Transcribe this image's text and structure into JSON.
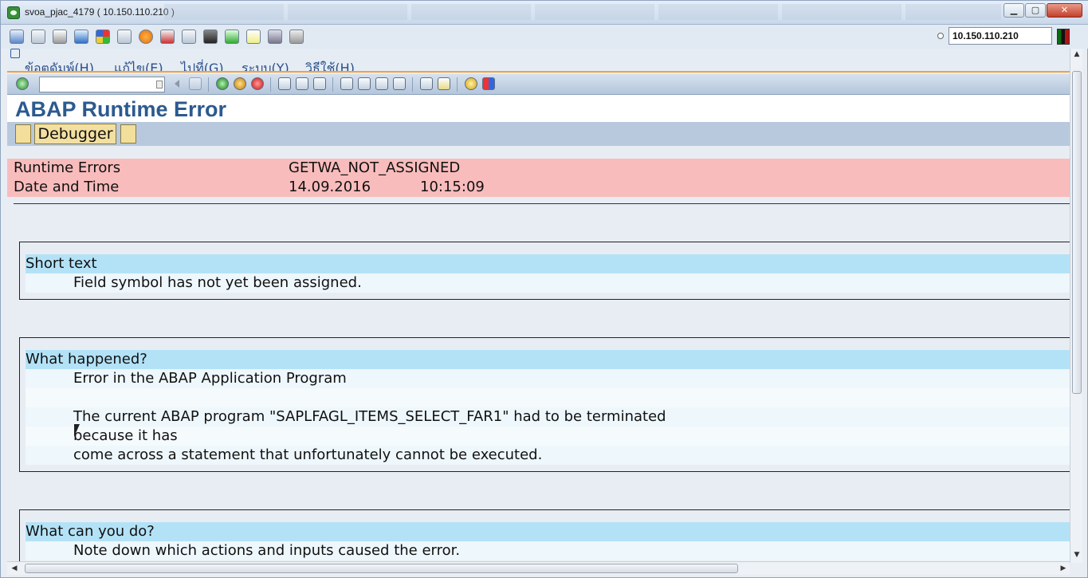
{
  "window": {
    "title": "svoa_pjac_4179 ( 10.150.110.210 )",
    "min_label": "▁",
    "max_label": "▢",
    "close_label": "✕"
  },
  "system": {
    "host": "10.150.110.210"
  },
  "menu": {
    "items": [
      {
        "label": "ข้อตดัมพ์(H)"
      },
      {
        "label": "แก้ไข(E)"
      },
      {
        "label": "ไปที่(G)"
      },
      {
        "label": "ระบบ(Y)"
      },
      {
        "label": "วิธีใช้(H)"
      }
    ]
  },
  "page": {
    "title": "ABAP Runtime Error",
    "debugger_label": "Debugger"
  },
  "error_header": {
    "rows": [
      {
        "label": "Runtime Errors",
        "value": "GETWA_NOT_ASSIGNED"
      },
      {
        "label": "Date and Time",
        "date": "14.09.2016",
        "time": "10:15:09"
      }
    ]
  },
  "sections": {
    "short_text": {
      "heading": "Short text",
      "lines": [
        "Field symbol has not yet been assigned."
      ]
    },
    "what_happened": {
      "heading": "What happened?",
      "lines": [
        "Error in the ABAP Application Program",
        "",
        "The current ABAP program \"SAPLFAGL_ITEMS_SELECT_FAR1\" had to be terminated",
        "because it has",
        "come across a statement that unfortunately cannot be executed."
      ]
    },
    "what_can_you_do": {
      "heading": "What can you do?",
      "lines": [
        "Note down which actions and inputs caused the error."
      ]
    }
  },
  "icons": {
    "system": [
      "monitor-icon",
      "windows-icon",
      "scissors-icon",
      "refresh-icon",
      "windows-flag-icon",
      "keyboard-icon",
      "alert-icon",
      "network-icon",
      "fullscreen-icon",
      "display-icon",
      "transfer-icon",
      "notepad-icon",
      "photo-icon",
      "chat-icon"
    ],
    "app": [
      "enter-icon",
      "save-icon",
      "back-icon",
      "exit-icon",
      "cancel-icon",
      "print-icon",
      "find-icon",
      "find-next-icon",
      "first-page-icon",
      "previous-page-icon",
      "next-page-icon",
      "last-page-icon",
      "create-session-icon",
      "shortcut-icon",
      "help-icon",
      "layout-icon"
    ]
  }
}
